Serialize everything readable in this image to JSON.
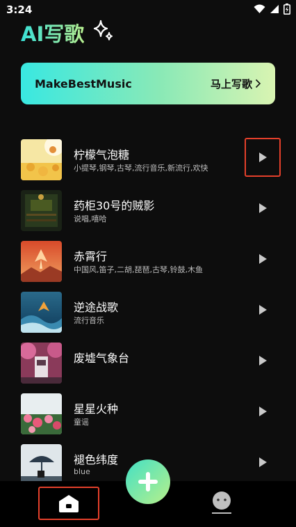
{
  "status_bar": {
    "time": "3:24"
  },
  "header": {
    "title": "AI写歌"
  },
  "banner": {
    "brand": "MakeBestMusic",
    "cta": "马上写歌"
  },
  "songs": [
    {
      "title": "柠檬气泡糖",
      "tags": "小提琴,钢琴,古琴,流行音乐,新流行,欢快"
    },
    {
      "title": "药柜30号的贼影",
      "tags": "说唱,嘻哈"
    },
    {
      "title": "赤霄行",
      "tags": "中国风,笛子,二胡,琵琶,古琴,铃鼓,木鱼"
    },
    {
      "title": "逆途战歌",
      "tags": "流行音乐"
    },
    {
      "title": "废墟气象台",
      "tags": ""
    },
    {
      "title": "星星火种",
      "tags": "童谣"
    },
    {
      "title": "褪色纬度",
      "tags": "blue"
    }
  ],
  "colors": {
    "accent_start": "#39e0d6",
    "accent_end": "#b7f090",
    "highlight": "#e5402b",
    "background": "#0d0d0d"
  },
  "icons": {
    "sparkle": "sparkle-icon",
    "play": "play-icon",
    "home": "home-icon",
    "profile": "profile-icon",
    "add": "plus-icon",
    "wifi": "wifi-icon",
    "signal": "signal-icon",
    "battery": "battery-icon"
  }
}
